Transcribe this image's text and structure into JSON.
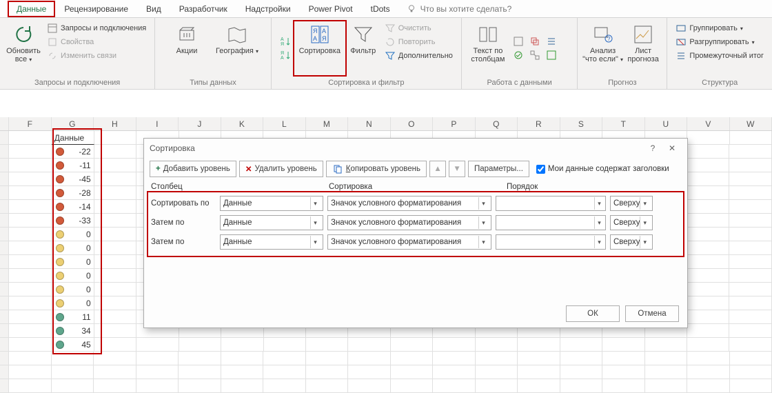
{
  "tabs": [
    "Данные",
    "Рецензирование",
    "Вид",
    "Разработчик",
    "Надстройки",
    "Power Pivot",
    "tDots"
  ],
  "tellme": "Что вы хотите сделать?",
  "ribbon": {
    "g1": {
      "btn": "Обновить все",
      "items": [
        "Запросы и подключения",
        "Свойства",
        "Изменить связи"
      ],
      "label": "Запросы и подключения"
    },
    "g2": {
      "b1": "Акции",
      "b2": "География",
      "label": "Типы данных"
    },
    "g3": {
      "sort": "Сортировка",
      "filter": "Фильтр",
      "i1": "Очистить",
      "i2": "Повторить",
      "i3": "Дополнительно",
      "label": "Сортировка и фильтр"
    },
    "g4": {
      "b1": "Текст по столбцам",
      "label": "Работа с данными"
    },
    "g5": {
      "b1": "Анализ \"что если\"",
      "b2": "Лист прогноза",
      "label": "Прогноз"
    },
    "g6": {
      "i1": "Группировать",
      "i2": "Разгруппировать",
      "i3": "Промежуточный итог",
      "label": "Структура"
    }
  },
  "columns": [
    "F",
    "G",
    "H",
    "I",
    "J",
    "K",
    "L",
    "M",
    "N",
    "O",
    "P",
    "Q",
    "R",
    "S",
    "T",
    "U",
    "V",
    "W"
  ],
  "data_header": "Данные",
  "data_rows": [
    {
      "color": "red",
      "v": -22
    },
    {
      "color": "red",
      "v": -11
    },
    {
      "color": "red",
      "v": -45
    },
    {
      "color": "red",
      "v": -28
    },
    {
      "color": "red",
      "v": -14
    },
    {
      "color": "red",
      "v": -33
    },
    {
      "color": "yellow",
      "v": 0
    },
    {
      "color": "yellow",
      "v": 0
    },
    {
      "color": "yellow",
      "v": 0
    },
    {
      "color": "yellow",
      "v": 0
    },
    {
      "color": "yellow",
      "v": 0
    },
    {
      "color": "yellow",
      "v": 0
    },
    {
      "color": "green",
      "v": 11
    },
    {
      "color": "green",
      "v": 34
    },
    {
      "color": "green",
      "v": 45
    }
  ],
  "dialog": {
    "title": "Сортировка",
    "add": "Добавить уровень",
    "del": "Удалить уровень",
    "copy": "Копировать уровень",
    "params": "Параметры...",
    "chk": "Мои данные содержат заголовки",
    "h1": "Столбец",
    "h2": "Сортировка",
    "h3": "Порядок",
    "rows": [
      {
        "label": "Сортировать по",
        "col": "Данные",
        "type": "Значок условного форматирования",
        "color": "red",
        "dir": "Сверху"
      },
      {
        "label": "Затем по",
        "col": "Данные",
        "type": "Значок условного форматирования",
        "color": "yellow",
        "dir": "Сверху"
      },
      {
        "label": "Затем по",
        "col": "Данные",
        "type": "Значок условного форматирования",
        "color": "green",
        "dir": "Сверху"
      }
    ],
    "ok": "ОК",
    "cancel": "Отмена"
  }
}
